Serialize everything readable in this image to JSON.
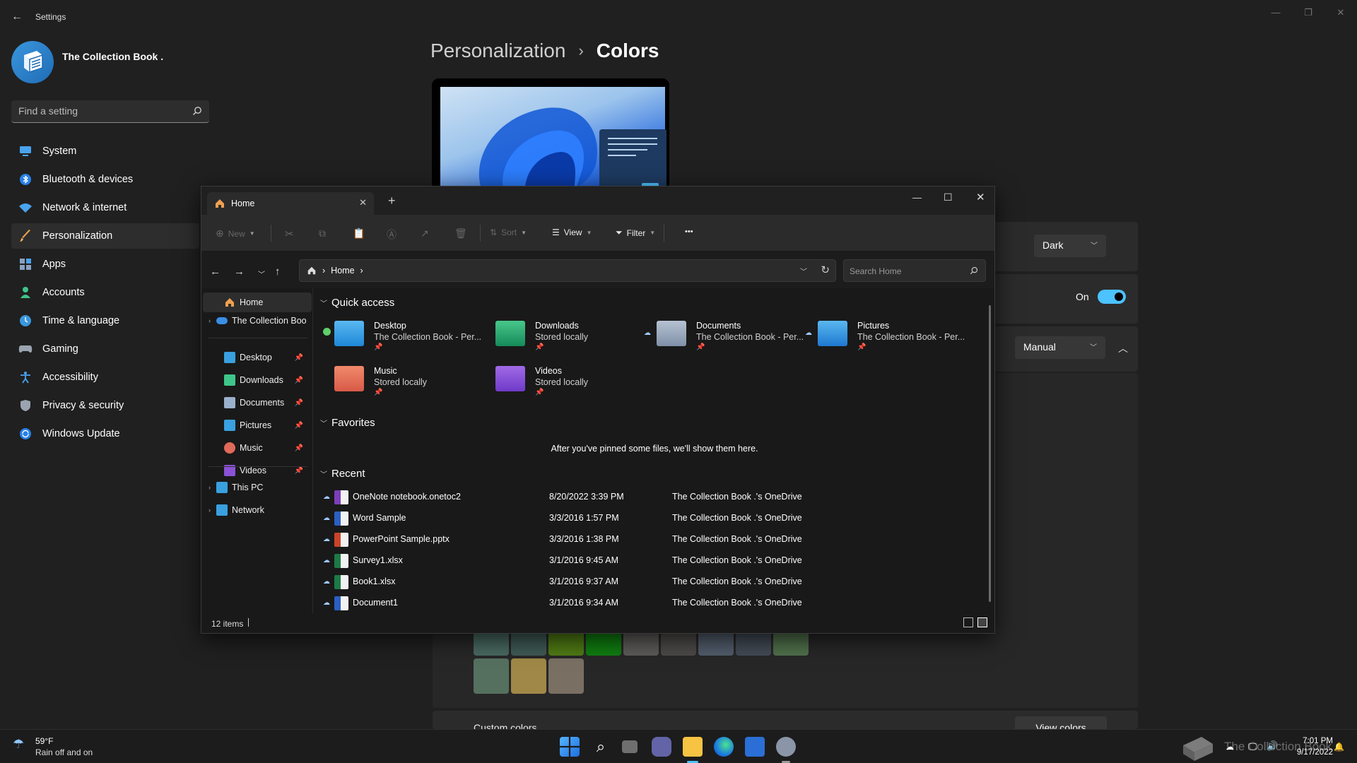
{
  "settings": {
    "app_title": "Settings",
    "user_name": "The Collection Book .",
    "search_placeholder": "Find a setting",
    "nav": [
      {
        "label": "System",
        "icon": "monitor-icon"
      },
      {
        "label": "Bluetooth & devices",
        "icon": "bluetooth-icon"
      },
      {
        "label": "Network & internet",
        "icon": "wifi-icon"
      },
      {
        "label": "Personalization",
        "icon": "brush-icon"
      },
      {
        "label": "Apps",
        "icon": "apps-icon"
      },
      {
        "label": "Accounts",
        "icon": "person-icon"
      },
      {
        "label": "Time & language",
        "icon": "globe-clock-icon"
      },
      {
        "label": "Gaming",
        "icon": "gamepad-icon"
      },
      {
        "label": "Accessibility",
        "icon": "accessibility-icon"
      },
      {
        "label": "Privacy & security",
        "icon": "shield-icon"
      },
      {
        "label": "Windows Update",
        "icon": "update-icon"
      }
    ],
    "breadcrumb": {
      "parent": "Personalization",
      "separator": "›",
      "current": "Colors"
    },
    "mode_value": "Dark",
    "transparency_label": "On",
    "accent_value": "Manual",
    "custom_colors_label": "Custom colors",
    "view_colors_label": "View colors",
    "accent_color": "#4cc2ff"
  },
  "explorer": {
    "tab_title": "Home",
    "toolbar": {
      "new": "New",
      "sort": "Sort",
      "view": "View",
      "filter": "Filter",
      "more": "•••"
    },
    "address": {
      "path": "Home",
      "sep": "›"
    },
    "search_placeholder": "Search Home",
    "sidebar": {
      "home": "Home",
      "onedrive": "The Collection Boo",
      "pinned": [
        "Desktop",
        "Downloads",
        "Documents",
        "Pictures",
        "Music",
        "Videos"
      ],
      "this_pc": "This PC",
      "network": "Network"
    },
    "quick_access_label": "Quick access",
    "quick_access": [
      {
        "name": "Desktop",
        "sub": "The Collection Book - Per..."
      },
      {
        "name": "Downloads",
        "sub": "Stored locally"
      },
      {
        "name": "Documents",
        "sub": "The Collection Book - Per..."
      },
      {
        "name": "Pictures",
        "sub": "The Collection Book - Per..."
      },
      {
        "name": "Music",
        "sub": "Stored locally"
      },
      {
        "name": "Videos",
        "sub": "Stored locally"
      }
    ],
    "favorites_label": "Favorites",
    "favorites_msg": "After you've pinned some files, we'll show them here.",
    "recent_label": "Recent",
    "recent": [
      {
        "name": "OneNote notebook.onetoc2",
        "date": "8/20/2022 3:39 PM",
        "loc": "The Collection Book .'s OneDrive",
        "kind": "onenote"
      },
      {
        "name": "Word Sample",
        "date": "3/3/2016 1:57 PM",
        "loc": "The Collection Book .'s OneDrive",
        "kind": "word"
      },
      {
        "name": "PowerPoint Sample.pptx",
        "date": "3/3/2016 1:38 PM",
        "loc": "The Collection Book .'s OneDrive",
        "kind": "ppt"
      },
      {
        "name": "Survey1.xlsx",
        "date": "3/1/2016 9:45 AM",
        "loc": "The Collection Book .'s OneDrive",
        "kind": "excel"
      },
      {
        "name": "Book1.xlsx",
        "date": "3/1/2016 9:37 AM",
        "loc": "The Collection Book .'s OneDrive",
        "kind": "excel"
      },
      {
        "name": "Document1",
        "date": "3/1/2016 9:34 AM",
        "loc": "The Collection Book .'s OneDrive",
        "kind": "word"
      }
    ],
    "status": "12 items"
  },
  "taskbar": {
    "weather_temp": "59°F",
    "weather_desc": "Rain off and on",
    "time": "7:01 PM",
    "date": "9/17/2022",
    "watermark": "The Collection Book"
  }
}
